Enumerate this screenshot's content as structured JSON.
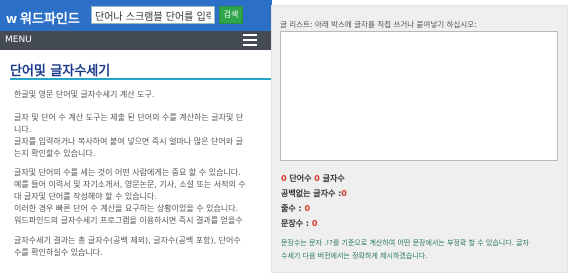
{
  "header": {
    "logo_mark": "W",
    "logo_text": "워드파인드",
    "search_value": "단어나 스크램블 단어를 입력하세요",
    "search_button": "검색",
    "menu_label": "MENU"
  },
  "main": {
    "title": "단어및 글자수세기",
    "paragraphs": [
      [
        "한글및 영문 단어및 글자수세기 계산 도구."
      ],
      [
        "글자 및 단어 수 계산 도구는 제출 된 단어의 수를 계산하는 글자및 단",
        "니다.",
        "글자를 입력하거나 복사하여 붙여 넣으면 즉시 얼마나 많은 단어와 글",
        "는지 확인할수 있습니다."
      ],
      [
        "글자및 단어의 수를 세는 것이 어떤 사람에게는 중요 할 수 있습니다.",
        "예를 들어 이력서 및 자기소개서, 영문논문, 기사, 소설 또는 서적의 수",
        "대 글자및 단어를 작성해야 할 수 있습니다.",
        "이러한 경우 빠른 단어 수 계산을 요구하는 상황이었을 수 있습니다.",
        "워드파인드의 글자수세기 프로그램을 이용하시면 즉시 결과를 얻을수"
      ],
      [
        "글자수세기 결과는 총 글자수(공백 제외), 글자수(공백 포함), 단어수",
        "수를 확인하실수 있습니다."
      ]
    ]
  },
  "counter": {
    "label": "글 리스트: 아래 박스에 글자를 직접 쓰거나 붙여넣기 하십시오:",
    "textarea_value": "",
    "stats": {
      "word_count": "0",
      "word_label": "단어수",
      "char_count": "0",
      "char_label": "글자수",
      "no_space_label": "공백없는 글자수 :",
      "no_space_count": "0",
      "lines_label": "줄수 :",
      "lines_count": "0",
      "sentences_label": "문장수 :",
      "sentences_count": "0"
    },
    "note": [
      "문장수는 문자 .!?를 기준으로 계산하여 어떤 문장에서는 부정확 할 수 있습니다. 글자",
      "수세기 다음 버전에서는 정확하게 제시하겠습니다."
    ]
  }
}
